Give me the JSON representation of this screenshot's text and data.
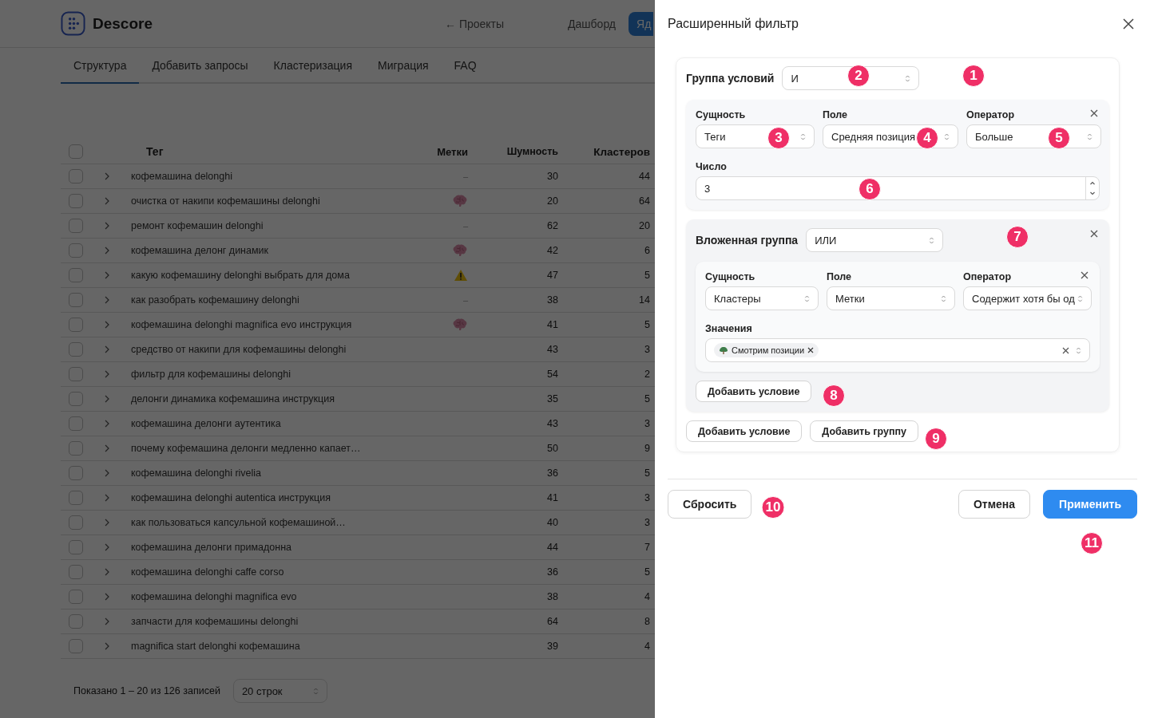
{
  "app": {
    "name": "Descore",
    "nav": [
      {
        "label": "← Проекты"
      },
      {
        "label": "Дашборд"
      }
    ],
    "cta": "Яд"
  },
  "tabs": [
    {
      "label": "Структура",
      "selected": true
    },
    {
      "label": "Добавить запросы",
      "selected": false
    },
    {
      "label": "Кластеризация",
      "selected": false
    },
    {
      "label": "Миграция",
      "selected": false
    },
    {
      "label": "FAQ",
      "selected": false
    }
  ],
  "table": {
    "select_all_checked": false,
    "columns": [
      "Тег",
      "Метки",
      "Шумность",
      "Кластеров"
    ],
    "rows": [
      {
        "checked": false,
        "tag": "кофемашина delonghi",
        "mark": {
          "kind": "dash",
          "text": "–"
        },
        "noise": "30",
        "clusters": "44"
      },
      {
        "checked": false,
        "tag": "очистка от накипи кофемашины delonghi",
        "mark": {
          "kind": "brain"
        },
        "noise": "20",
        "clusters": "64"
      },
      {
        "checked": false,
        "tag": "ремонт кофемашин delonghi",
        "mark": {
          "kind": "dash",
          "text": "–"
        },
        "noise": "62",
        "clusters": "20"
      },
      {
        "checked": false,
        "tag": "кофемашина делонг динамик",
        "mark": {
          "kind": "brain"
        },
        "noise": "42",
        "clusters": "6"
      },
      {
        "checked": false,
        "tag": "какую кофемашину delonghi выбрать для дома",
        "mark": {
          "kind": "warning"
        },
        "noise": "47",
        "clusters": "5"
      },
      {
        "checked": false,
        "tag": "как разобрать кофемашину delonghi",
        "mark": {
          "kind": "dash",
          "text": "–"
        },
        "noise": "38",
        "clusters": "14"
      },
      {
        "checked": false,
        "tag": "кофемашина delonghi magnifica evo инструкция",
        "mark": {
          "kind": "brain"
        },
        "noise": "41",
        "clusters": "5"
      },
      {
        "checked": false,
        "tag": "средство от накипи для кофемашины delonghi",
        "noise": "43",
        "clusters": "3"
      },
      {
        "checked": false,
        "tag": "фильтр для кофемашины delonghi",
        "noise": "54",
        "clusters": "2"
      },
      {
        "checked": false,
        "tag": "делонги динамика кофемашина инструкция",
        "noise": "35",
        "clusters": "5"
      },
      {
        "checked": false,
        "tag": "кофемашина делонги аутентика",
        "noise": "43",
        "clusters": "3"
      },
      {
        "checked": false,
        "tag": "почему кофемашина делонги медленно капает…",
        "noise": "50",
        "clusters": "9"
      },
      {
        "checked": false,
        "tag": "кофемашина delonghi rivelia",
        "noise": "36",
        "clusters": "5"
      },
      {
        "checked": false,
        "tag": "кофемашина delonghi autentica инструкция",
        "noise": "41",
        "clusters": "3"
      },
      {
        "checked": false,
        "tag": "как пользоваться капсульной кофемашиной…",
        "noise": "40",
        "clusters": "3"
      },
      {
        "checked": false,
        "tag": "кофемашина делонги примадонна",
        "noise": "44",
        "clusters": "7"
      },
      {
        "checked": false,
        "tag": "кофемашина delonghi caffe corso",
        "noise": "36",
        "clusters": "5"
      },
      {
        "checked": false,
        "tag": "кофемашина delonghi magnifica evo",
        "noise": "38",
        "clusters": "4"
      },
      {
        "checked": false,
        "tag": "запчасти для кофемашины delonghi",
        "noise": "64",
        "clusters": "8"
      },
      {
        "checked": false,
        "tag": "magnifica start delonghi кофемашина",
        "noise": "39",
        "clusters": "4"
      }
    ]
  },
  "pagination": {
    "summary": "Показано 1 – 20 из 126 записей",
    "page_size": "20 строк"
  },
  "filter": {
    "title": "Расширенный фильтр",
    "group": {
      "label": "Группа условий",
      "operator": "И"
    },
    "condition": {
      "fields": [
        {
          "label": "Сущность",
          "value": "Теги"
        },
        {
          "label": "Поле",
          "value": "Средняя позиция"
        },
        {
          "label": "Оператор",
          "value": "Больше"
        }
      ],
      "number": {
        "label": "Число",
        "value": "3"
      }
    },
    "nested": {
      "label": "Вложенная группа",
      "operator": "ИЛИ",
      "condition": {
        "fields": [
          {
            "label": "Сущность",
            "value": "Кластеры"
          },
          {
            "label": "Поле",
            "value": "Метки"
          },
          {
            "label": "Оператор",
            "value": "Содержит хотя бы од"
          }
        ],
        "values": {
          "label": "Значения",
          "chips": [
            {
              "label": "Смотрим позиции"
            }
          ]
        }
      },
      "add_condition": "Добавить условие"
    },
    "add_condition": "Добавить условие",
    "add_group": "Добавить группу",
    "reset": "Сбросить",
    "cancel": "Отмена",
    "apply": "Применить"
  },
  "annotations": [
    "1",
    "2",
    "3",
    "4",
    "5",
    "6",
    "7",
    "8",
    "9",
    "10",
    "11"
  ]
}
